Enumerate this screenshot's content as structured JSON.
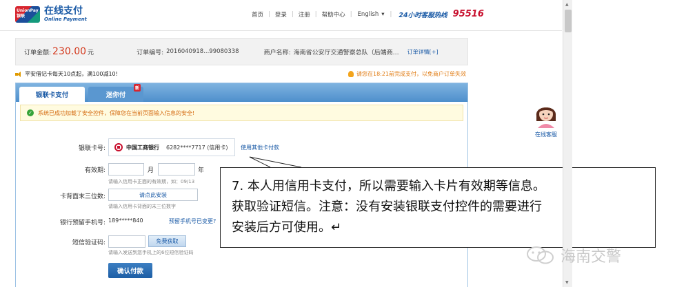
{
  "header": {
    "logo_badge": "UnionPay 银联",
    "logo_cn": "在线支付",
    "logo_en": "Online Payment",
    "nav": [
      "首页",
      "登录",
      "注册",
      "帮助中心"
    ],
    "language": "English",
    "hotline_label": "24小时客服热线",
    "hotline_number": "95516"
  },
  "order": {
    "amount_label": "订单金额:",
    "amount": "230.00",
    "currency": "元",
    "order_no_label": "订单编号:",
    "order_no": "2016040918...99080338",
    "merchant_label": "商户名称:",
    "merchant": "海南省公安厅交通警察总队（后端商…",
    "detail_link": "订单详情[+]"
  },
  "notices": {
    "left": "平安借记卡每天10点起，满100减10!",
    "right": "请您在18:21前完成支付，以免商户订单失效"
  },
  "tabs": {
    "active": "银联卡支付",
    "mini": "迷你付",
    "mini_badge": "新"
  },
  "security_msg": "系统已成功加载了安全控件，保障您在当前页面输入信息的安全!",
  "form": {
    "card_label": "银联卡号:",
    "bank_name": "中国工商银行",
    "card_number": "6282****7717 (信用卡)",
    "other_card": "使用其他卡付款",
    "expiry_label": "有效期:",
    "month_unit": "月",
    "year_unit": "年",
    "expiry_hint": "请输入信用卡正面的有效期，如：09/13",
    "cvv_label": "卡背面末三位数:",
    "cvv_button": "请点此安装",
    "cvv_hint": "请输入信用卡背面的末三位数字",
    "phone_label": "银行预留手机号:",
    "phone": "189*****840",
    "phone_change": "预留手机号已变更?",
    "sms_label": "短信验证码:",
    "sms_button": "免费获取",
    "sms_hint": "请输入发送到您手机上的6位短信验证码",
    "confirm": "确认付款"
  },
  "callout": {
    "line1": "7. 本人用信用卡支付，所以需要输入卡片有效期等信息。",
    "line2": "获取验证短信。注意：没有安装银联支付控件的需要进行",
    "line3": "安装后方可使用。↵"
  },
  "service_label": "在线客服",
  "watermark": "海南交警"
}
